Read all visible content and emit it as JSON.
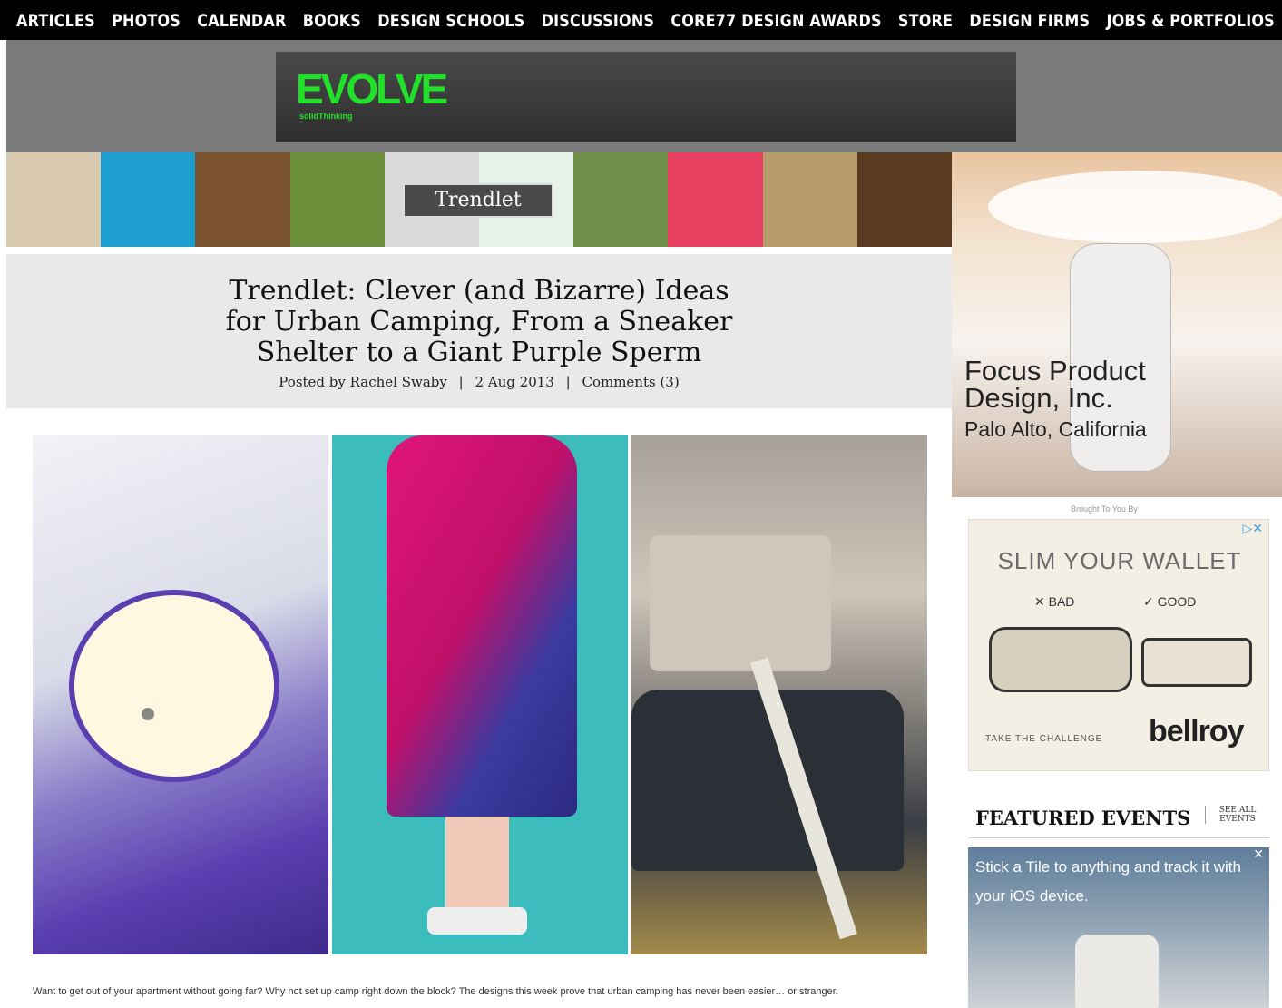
{
  "nav": {
    "items": [
      "ARTICLES",
      "PHOTOS",
      "CALENDAR",
      "BOOKS",
      "DESIGN SCHOOLS",
      "DISCUSSIONS",
      "CORE77 DESIGN AWARDS",
      "STORE",
      "DESIGN FIRMS",
      "JOBS & PORTFOLIOS"
    ]
  },
  "banner": {
    "logo": "EVOLVE",
    "sub": "solidThinking"
  },
  "strip": {
    "label": "Trendlet",
    "thumbs": [
      "#d8c9b0",
      "#1c9fd0",
      "#7a5230",
      "#6b8e3a",
      "#d9d9d9",
      "#e6f2ea",
      "#6f8f4a",
      "#e84060",
      "#b79b6a",
      "#5a3b22"
    ]
  },
  "article": {
    "title": "Trendlet: Clever (and Bizarre) Ideas for Urban Camping, From a Sneaker Shelter to a Giant Purple Sperm",
    "author": "Posted by Rachel Swaby",
    "date": "2 Aug 2013",
    "comments": "Comments (3)",
    "intro": "Want to get out of your apartment without going far? Why not set up camp right down the block? The designs this week prove that urban camping has never been easier… or stranger."
  },
  "sidebar": {
    "focus_line1": "Focus Product",
    "focus_line2": "Design, Inc.",
    "focus_line3": "Palo Alto, California",
    "brought": "Brought To You By",
    "wallet": {
      "title": "SLIM YOUR WALLET",
      "bad": "✕ BAD",
      "good": "✓ GOOD",
      "challenge": "TAKE THE CHALLENGE",
      "brand": "bellroy"
    },
    "events": {
      "title": "FEATURED EVENTS",
      "link": "SEE ALL EVENTS"
    },
    "tile": {
      "text": "Stick a Tile to anything and track it with your iOS device."
    }
  }
}
